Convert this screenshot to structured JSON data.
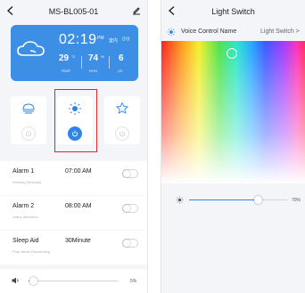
{
  "left": {
    "title": "MS-BL005-01",
    "weather": {
      "time": "02:19",
      "ampm": "PM",
      "channel": "室内",
      "signal": "((•))",
      "temperature": "29",
      "temperature_unit": "°C",
      "temperature_label": "TEMP",
      "humidity": "74",
      "humidity_unit": "%",
      "humidity_label": "RH%",
      "uv": "6",
      "uv_label": "UV"
    },
    "alarms": [
      {
        "name": "Alarm 1",
        "time": "07:00 AM",
        "repeat": "Working Weekday"
      },
      {
        "name": "Alarm 2",
        "time": "08:00 AM",
        "repeat": "Valley Weekend"
      }
    ],
    "sleep_aid": {
      "name": "Sleep Aid",
      "duration": "30Minute",
      "description": "Prop Weak Descending"
    },
    "volume": {
      "percent_label": "5%",
      "level": 0.05
    }
  },
  "right": {
    "title": "Light Switch",
    "voice_control_label": "Voice Control Name",
    "voice_control_value": "Light Switch >",
    "brightness": {
      "percent_label": "70%",
      "level": 0.7
    }
  },
  "colors": {
    "accent": "#2f85e6",
    "weather_card": "#3d8fe6",
    "highlight_box": "#d92b2b"
  }
}
